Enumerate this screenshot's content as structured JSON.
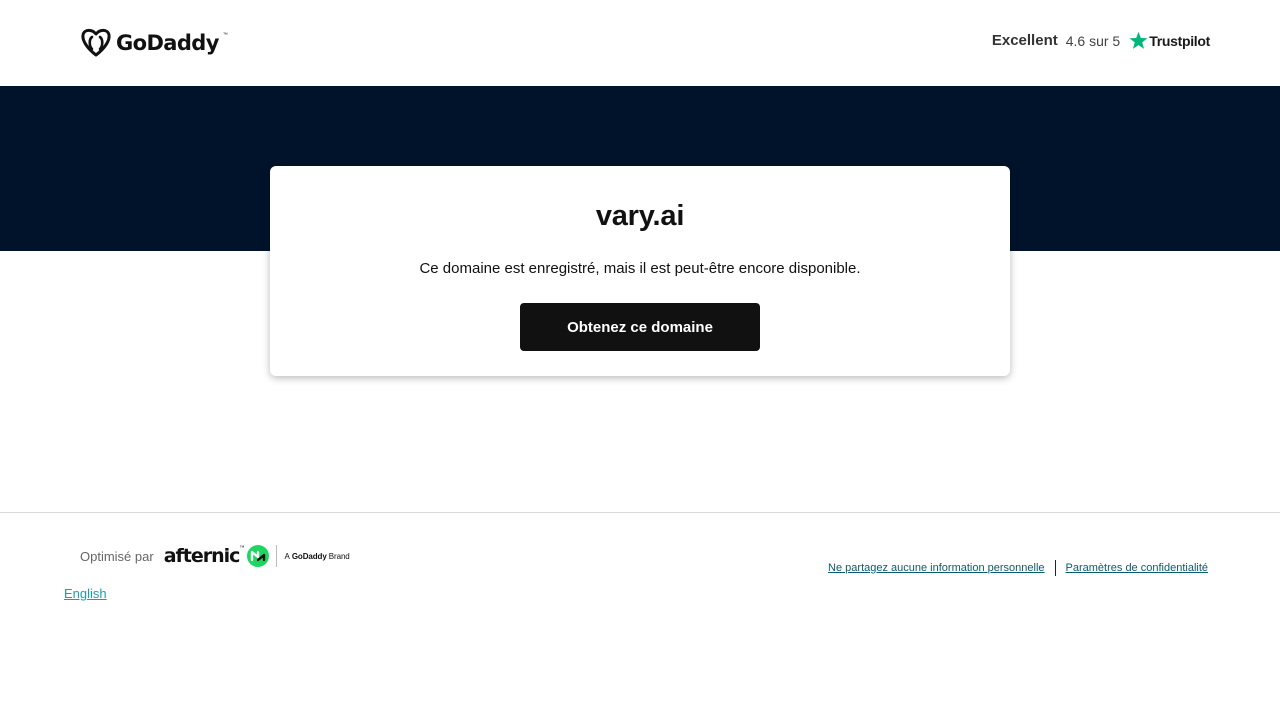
{
  "header": {
    "logo_text": "GoDaddy",
    "logo_tm": "™",
    "trustpilot": {
      "rating_word": "Excellent",
      "score": "4.6 sur 5",
      "brand": "Trustpilot",
      "star_color": "#00b67a"
    }
  },
  "hero": {
    "background": "#00132b"
  },
  "card": {
    "domain": "vary.ai",
    "message": "Ce domaine est enregistré, mais il est peut-être encore disponible.",
    "cta_label": "Obtenez ce domaine"
  },
  "footer": {
    "powered_label": "Optimisé par",
    "afternic_text": "afternic",
    "afternic_tm": "™",
    "afternic_color": "#1bd760",
    "brand_tag_a": "A",
    "brand_tag_name": "GoDaddy",
    "brand_tag_suffix": "Brand",
    "language_link": "English",
    "links": [
      {
        "label": "Ne partagez aucune information personnelle"
      },
      {
        "label": "Paramètres de confidentialité"
      }
    ]
  }
}
